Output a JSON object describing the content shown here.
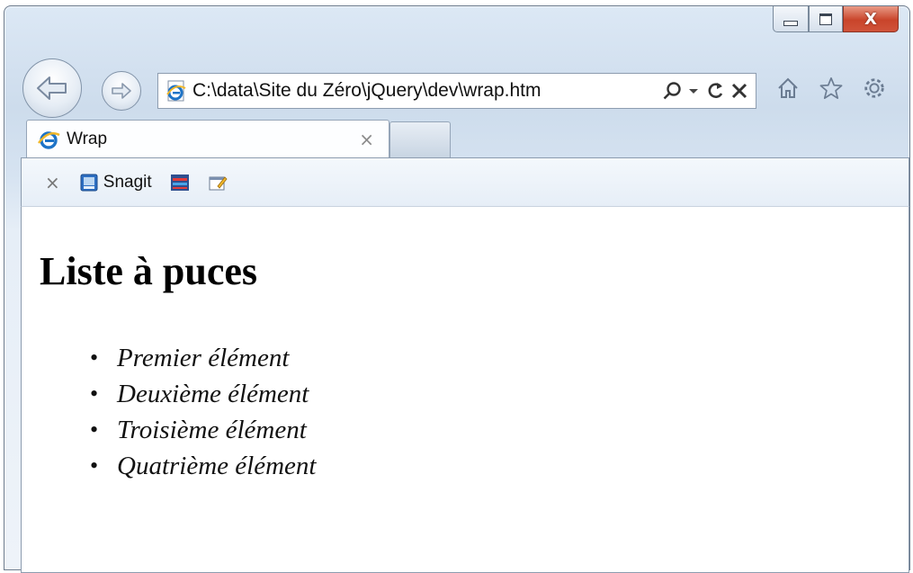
{
  "window": {
    "address": "C:\\data\\Site du Zéro\\jQuery\\dev\\wrap.htm",
    "tab_title": "Wrap",
    "tab_close": "×"
  },
  "commandbar": {
    "close_glyph": "×",
    "snagit_label": "Snagit"
  },
  "page": {
    "heading": "Liste à puces",
    "items": [
      "Premier élément",
      "Deuxième élément",
      "Troisième élément",
      "Quatrième élément"
    ]
  },
  "icons": {
    "back": "back-arrow-icon",
    "forward": "forward-arrow-icon",
    "page": "ie-page-icon",
    "search": "search-icon",
    "dropdown": "dropdown-arrow-icon",
    "refresh": "refresh-icon",
    "stop": "stop-icon",
    "home": "home-icon",
    "favorites": "star-icon",
    "tools": "gear-icon"
  },
  "colors": {
    "close_button": "#c9442a",
    "frame": "#dce8f5",
    "ie_blue": "#1e74c7"
  }
}
